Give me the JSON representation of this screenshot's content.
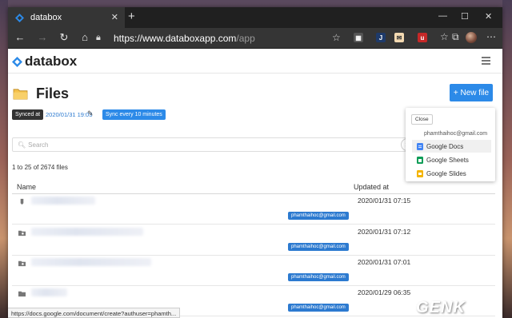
{
  "browser": {
    "tab_title": "databox",
    "tab_close": "✕",
    "new_tab": "+",
    "window_controls": [
      "—",
      "☐",
      "✕"
    ],
    "url_host": "https://www.databoxapp.com",
    "url_path": "/app",
    "icons": [
      "back-icon",
      "forward-icon",
      "refresh-icon",
      "home-icon",
      "lock-icon",
      "star-icon"
    ]
  },
  "app": {
    "brand": "databox",
    "page_title": "Files",
    "new_file_label": "+ New file",
    "synced_label": "Synced at",
    "synced_time": "2020/01/31 19:03",
    "sync_interval_label": "Sync every 10 minutes",
    "search_placeholder": "Search",
    "file_count": "1 to 25 of 2674 files",
    "columns": [
      "Name",
      "Updated at"
    ],
    "rows": [
      {
        "icon": "file-icon",
        "owner": "phamthaihoc@gmail.com",
        "updated": "2020/01/31 07:15"
      },
      {
        "icon": "shared-folder-icon",
        "owner": "phamthaihoc@gmail.com",
        "updated": "2020/01/31 07:12"
      },
      {
        "icon": "shared-folder-icon",
        "owner": "phamthaihoc@gmail.com",
        "updated": "2020/01/31 07:01"
      },
      {
        "icon": "folder-icon",
        "owner": "phamthaihoc@gmail.com",
        "updated": "2020/01/29 06:35"
      }
    ]
  },
  "dropdown": {
    "close_label": "Close",
    "account": "phamthaihoc@gmail.com",
    "items": [
      {
        "label": "Google Docs",
        "color": "#4285f4"
      },
      {
        "label": "Google Sheets",
        "color": "#0f9d58"
      },
      {
        "label": "Google Slides",
        "color": "#f4b400"
      }
    ]
  },
  "status_url": "https://docs.google.com/document/create?authuser=phamth...",
  "watermark": "GENK",
  "colors": {
    "accent": "#2c8ae8",
    "tab_bar": "#202020",
    "address_bar": "#353535"
  }
}
